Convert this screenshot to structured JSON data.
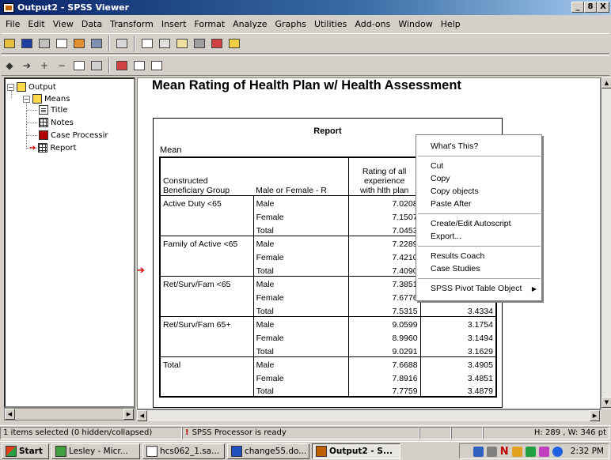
{
  "window": {
    "title": "Output2 - SPSS Viewer",
    "min": "_",
    "restore": "8",
    "close": "X"
  },
  "menubar": [
    "File",
    "Edit",
    "View",
    "Data",
    "Transform",
    "Insert",
    "Format",
    "Analyze",
    "Graphs",
    "Utilities",
    "Add-ons",
    "Window",
    "Help"
  ],
  "outline": {
    "items": [
      {
        "label": "Output",
        "expander": "−"
      },
      {
        "label": "Means",
        "expander": "−"
      },
      {
        "label": "Title"
      },
      {
        "label": "Notes"
      },
      {
        "label": "Case Processir"
      },
      {
        "label": "Report"
      }
    ]
  },
  "content": {
    "heading": "Mean Rating of Health Plan w/ Health Assessment",
    "report": {
      "title": "Report",
      "stat_label": "Mean",
      "headers": {
        "group_line1": "Constructed",
        "group_line2": "Beneficiary Group",
        "sex": "Male or Female  - R",
        "rating_line1": "Rating of all",
        "rating_line2": "experience",
        "rating_line3": "with hlth plan",
        "col4": ""
      },
      "rows": [
        {
          "group": "Active Duty <65",
          "sex": "Male",
          "rating": "7.0208",
          "col4": ""
        },
        {
          "group": "",
          "sex": "Female",
          "rating": "7.1507",
          "col4": ""
        },
        {
          "group": "",
          "sex": "Total",
          "rating": "7.0453",
          "col4": ""
        },
        {
          "group": "Family of Active <65",
          "sex": "Male",
          "rating": "7.2289",
          "col4": ""
        },
        {
          "group": "",
          "sex": "Female",
          "rating": "7.4210",
          "col4": ""
        },
        {
          "group": "",
          "sex": "Total",
          "rating": "7.4090",
          "col4": ""
        },
        {
          "group": "Ret/Surv/Fam <65",
          "sex": "Male",
          "rating": "7.3851",
          "col4": ""
        },
        {
          "group": "",
          "sex": "Female",
          "rating": "7.6776",
          "col4": "3.5156"
        },
        {
          "group": "",
          "sex": "Total",
          "rating": "7.5315",
          "col4": "3.4334"
        },
        {
          "group": "Ret/Surv/Fam 65+",
          "sex": "Male",
          "rating": "9.0599",
          "col4": "3.1754"
        },
        {
          "group": "",
          "sex": "Female",
          "rating": "8.9960",
          "col4": "3.1494"
        },
        {
          "group": "",
          "sex": "Total",
          "rating": "9.0291",
          "col4": "3.1629"
        },
        {
          "group": "Total",
          "sex": "Male",
          "rating": "7.6688",
          "col4": "3.4905"
        },
        {
          "group": "",
          "sex": "Female",
          "rating": "7.8916",
          "col4": "3.4851"
        },
        {
          "group": "",
          "sex": "Total",
          "rating": "7.7759",
          "col4": "3.4879"
        }
      ]
    }
  },
  "context_menu": {
    "items": [
      "What's This?",
      "Cut",
      "Copy",
      "Copy objects",
      "Paste After",
      "Create/Edit Autoscript",
      "Export...",
      "Results Coach",
      "Case Studies",
      "SPSS Pivot Table Object"
    ],
    "submenu_arrow": "▶"
  },
  "status": {
    "selection": "1 items selected (0 hidden/collapsed)",
    "processor": "SPSS Processor  is ready",
    "dimensions": "H: 289 , W: 346  pt"
  },
  "taskbar": {
    "start": "Start",
    "buttons": [
      "Lesley - Micr...",
      "hcs062_1.sa...",
      "change55.do...",
      "Output2 - S..."
    ],
    "clock": "2:32 PM"
  },
  "colors": {
    "title_bar": "#0a246a",
    "arrow_red": "#e00000",
    "window_face": "#d4d0c8"
  }
}
